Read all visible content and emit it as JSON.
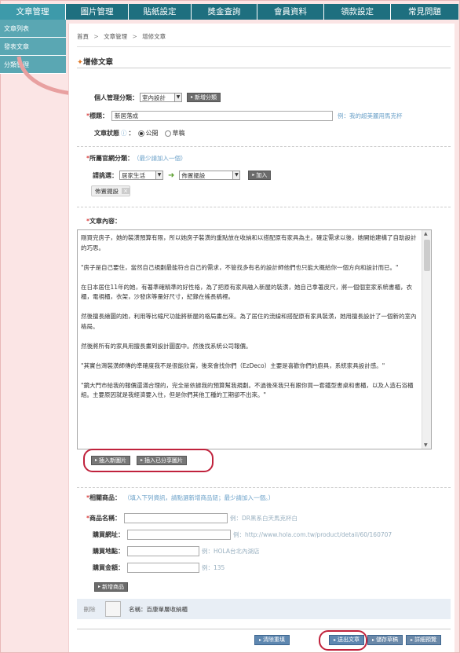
{
  "top_nav": [
    "文章管理",
    "圖片管理",
    "貼紙設定",
    "獎金查詢",
    "會員資料",
    "領款設定",
    "常見問題"
  ],
  "side_nav": [
    "文章列表",
    "發表文章",
    "分類管理"
  ],
  "breadcrumb": [
    "首頁",
    "文章管理",
    "增修文章"
  ],
  "page_title": "增修文章",
  "category": {
    "label": "個人管理分類：",
    "value": "室內設計",
    "add_button": "新增分類"
  },
  "title_field": {
    "label": "標題：",
    "value": "新居落成",
    "hint": "例：我的超美麗用馬克杯"
  },
  "status": {
    "label": "文章狀態",
    "options": [
      "公開",
      "草稿"
    ],
    "selected": "公開"
  },
  "official_category": {
    "label": "所屬官網分類：",
    "hint": "（最少請加入一個）",
    "select_label": "請挑選：",
    "first": "居家生活",
    "second": "佈置擺設",
    "add_button": "加入",
    "tag": "佈置擺設"
  },
  "content": {
    "label": "文章內容：",
    "paragraphs": [
      "剛買完房子，她的裝潢預算有限，所以她房子裝潢的重點放在收納和以搭配原有家具為主。確定需求以後，她開始建構了自助設計的巧思。",
      "\"房子是自己要住，當然自己規劃最能符合自己的需求，不管找多有名的設計師他們也只能大概給你一個方向和設計而已。\"",
      "在日本居住11年的她，有著準確精準的好性格，為了把原有家具融入新屋的裝潢，她自己拿著皮尺，將一個個室家系統書櫃，衣櫃，電視櫃，衣架，沙發床等量好尺寸，紀錄在搖長稿裡。",
      "然後擅長繪圖的她，利用等比縮尺功能將新屋的格局畫出來。為了居住的流線和搭配原有家具裝潢，她用擅長設計了一個新的室內格局。",
      "然後將所有的家具用擅長畫到設計圖面中。然後找系統公司報價。",
      "\"其實台灣裝潢師傳的準確度我不是很能欣賞，後來會找你們（EzDeco）主要是喜歡你們的廚具，系統家具設計感。\"",
      "\"鏡大門市給我的報價還滿合理的，完全是依據我的預算幫我規劃。不過後來我只有跟你買一套鐵型書桌和書櫃，以及人造石浴櫃組。主要原因就是我經濟要入住，但是你們其他工種的工期卻不出來。\""
    ],
    "insert_new_image": "插入新圖片",
    "insert_shared_image": "插入已分享圖片"
  },
  "related_products": {
    "label": "相關商品：",
    "hint": "（填入下列資訊，請點選新增商品鈕；最少請加入一個。）",
    "fields": [
      {
        "label": "商品名稱：",
        "required": true,
        "hint": "例：DR黑系白天馬克杯白"
      },
      {
        "label": "購買網址：",
        "required": false,
        "hint": "例：http://www.hola.com.tw/product/detail/60/160707"
      },
      {
        "label": "購買地點：",
        "required": false,
        "hint": "例：HOLA台北內湖店"
      },
      {
        "label": "購買金額：",
        "required": false,
        "hint": "例：135"
      }
    ],
    "add_button": "新增商品",
    "item": {
      "delete": "刪除",
      "name": "名稱：百康單層收納櫃"
    }
  },
  "footer_buttons": [
    "清除重填",
    "送出文章",
    "儲存草稿",
    "詳細預覽"
  ]
}
